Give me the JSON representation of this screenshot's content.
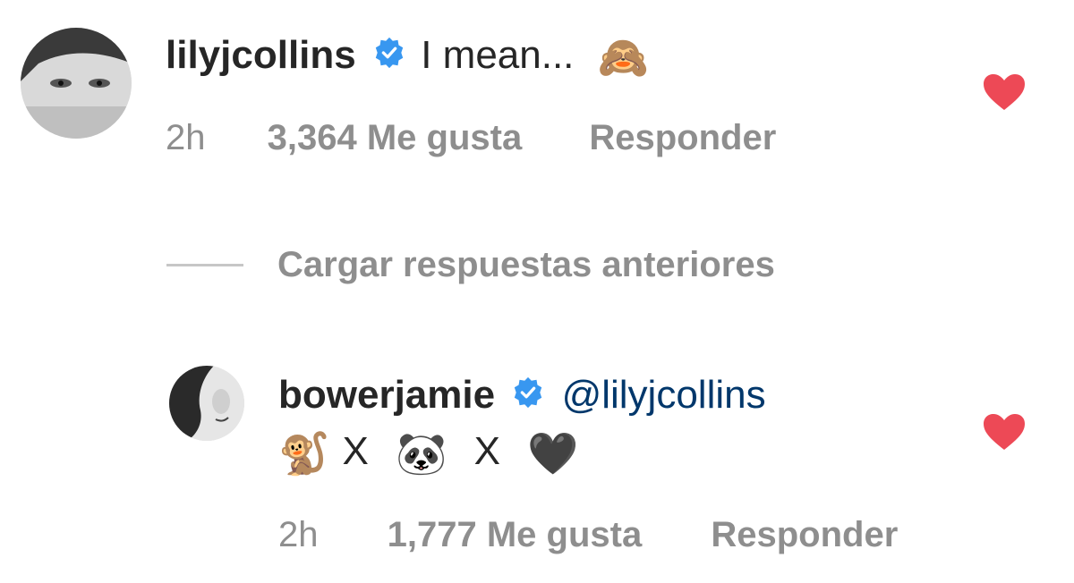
{
  "colors": {
    "text": "#262626",
    "muted": "#8e8e8e",
    "mention": "#00376b",
    "verified": "#3897f0",
    "heart": "#ed4956"
  },
  "comment": {
    "username": "lilyjcollins",
    "verified_icon": "verified-badge-icon",
    "text": "I mean...",
    "emoji": "🙈",
    "time": "2h",
    "likes": "3,364 Me gusta",
    "reply": "Responder",
    "liked_icon": "heart-filled-icon"
  },
  "load_replies": {
    "label": "Cargar respuestas anteriores"
  },
  "reply": {
    "username": "bowerjamie",
    "verified_icon": "verified-badge-icon",
    "mention": "@lilyjcollins",
    "emoji_1": "🐒",
    "sep_1": "X",
    "emoji_2": "🐼",
    "sep_2": "X",
    "emoji_3": "🖤",
    "time": "2h",
    "likes": "1,777 Me gusta",
    "reply": "Responder",
    "liked_icon": "heart-filled-icon"
  }
}
